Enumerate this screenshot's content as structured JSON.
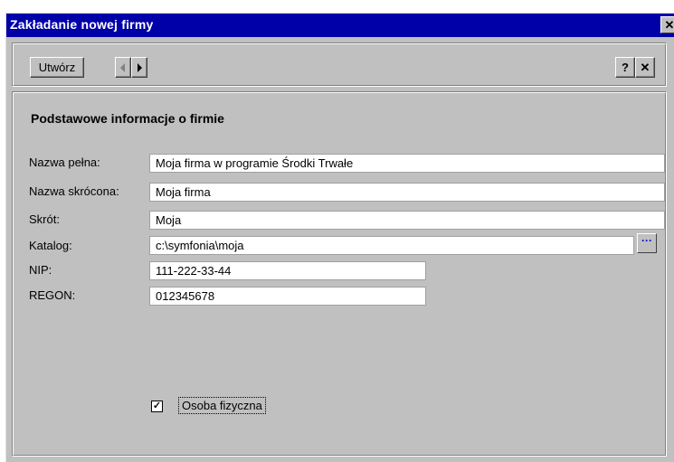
{
  "window": {
    "title": "Zakładanie nowej firmy",
    "close_glyph": "✕"
  },
  "toolbar": {
    "create_label": "Utwórz",
    "help_label": "?",
    "close_label": "✕"
  },
  "form": {
    "section_title": "Podstawowe informacje o firmie",
    "fields": [
      {
        "label": "Nazwa pełna:",
        "value": "Moja firma w programie Środki Trwałe"
      },
      {
        "label": "Nazwa skrócona:",
        "value": "Moja firma"
      },
      {
        "label": "Skrót:",
        "value": "Moja"
      },
      {
        "label": "Katalog:",
        "value": "c:\\symfonia\\moja"
      },
      {
        "label": "NIP:",
        "value": "111-222-33-44"
      },
      {
        "label": "REGON:",
        "value": "012345678"
      }
    ],
    "browse_label": "···",
    "checkbox": {
      "label": "Osoba fizyczna",
      "checked": true,
      "mark": "✓"
    }
  },
  "colors": {
    "titlebar": "#0000a8",
    "face": "#c0c0c0",
    "browse_dots": "#0000c0"
  }
}
